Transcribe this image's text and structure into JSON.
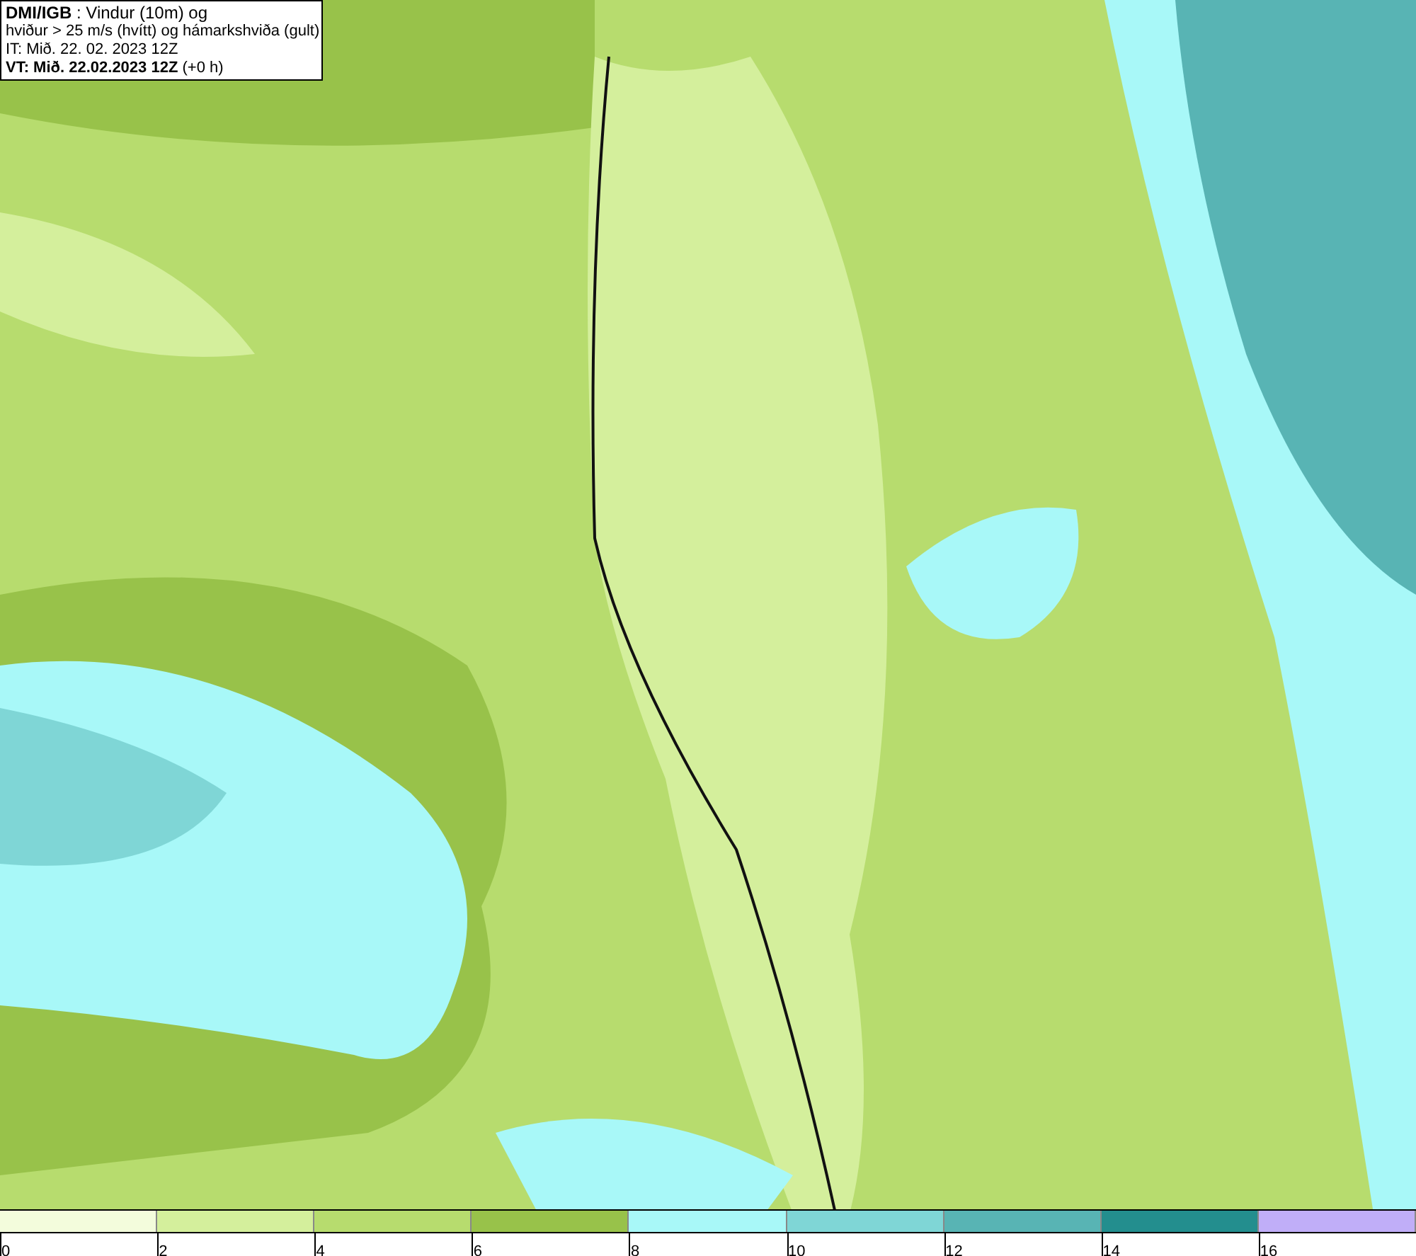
{
  "header": {
    "title": "**DMI/IGB** : Vindur (10m) og",
    "subtitle": "hviður > 25 m/s (hvítt) og hámarkshviða (gult)",
    "initial_time": "IT: Mið. 22. 02. 2023 12Z",
    "valid_time": "**VT: Mið. 22.02.2023 12Z** (+0 h)"
  },
  "legend": {
    "bins": [
      {
        "color": "#f3fcdc"
      },
      {
        "color": "#d4ef9c"
      },
      {
        "color": "#b7dc6e"
      },
      {
        "color": "#98c24a"
      },
      {
        "color": "#a8f8f8"
      },
      {
        "color": "#7fd6d6"
      },
      {
        "color": "#58b4b4"
      },
      {
        "color": "#238e8e"
      },
      {
        "color": "#c0aef8"
      }
    ],
    "labels": [
      "0",
      "2",
      "4",
      "6",
      "8",
      "10",
      "12",
      "14",
      "16"
    ]
  }
}
